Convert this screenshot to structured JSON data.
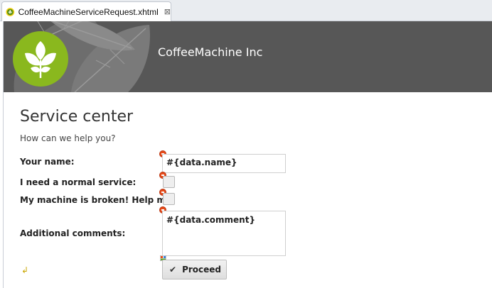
{
  "editor_tab": {
    "title": "CoffeeMachineServiceRequest.xhtml",
    "close_glyph": "⊠",
    "icon": "primefaces-file-icon"
  },
  "header": {
    "brand_name": "CoffeeMachine Inc",
    "logo": "coffee-leaf-logo",
    "banner_color": "#575757",
    "logo_color": "#8ab81e"
  },
  "form": {
    "title": "Service center",
    "subtitle": "How can we help you?",
    "name_label": "Your name:",
    "name_value": "#{data.name}",
    "normal_service_label": "I need a normal service:",
    "broken_label": "My machine is broken! Help me:",
    "comments_label": "Additional comments:",
    "comments_value": "#{data.comment}",
    "proceed_label": "Proceed",
    "proceed_icon": "check-icon",
    "return_glyph": "↲"
  }
}
